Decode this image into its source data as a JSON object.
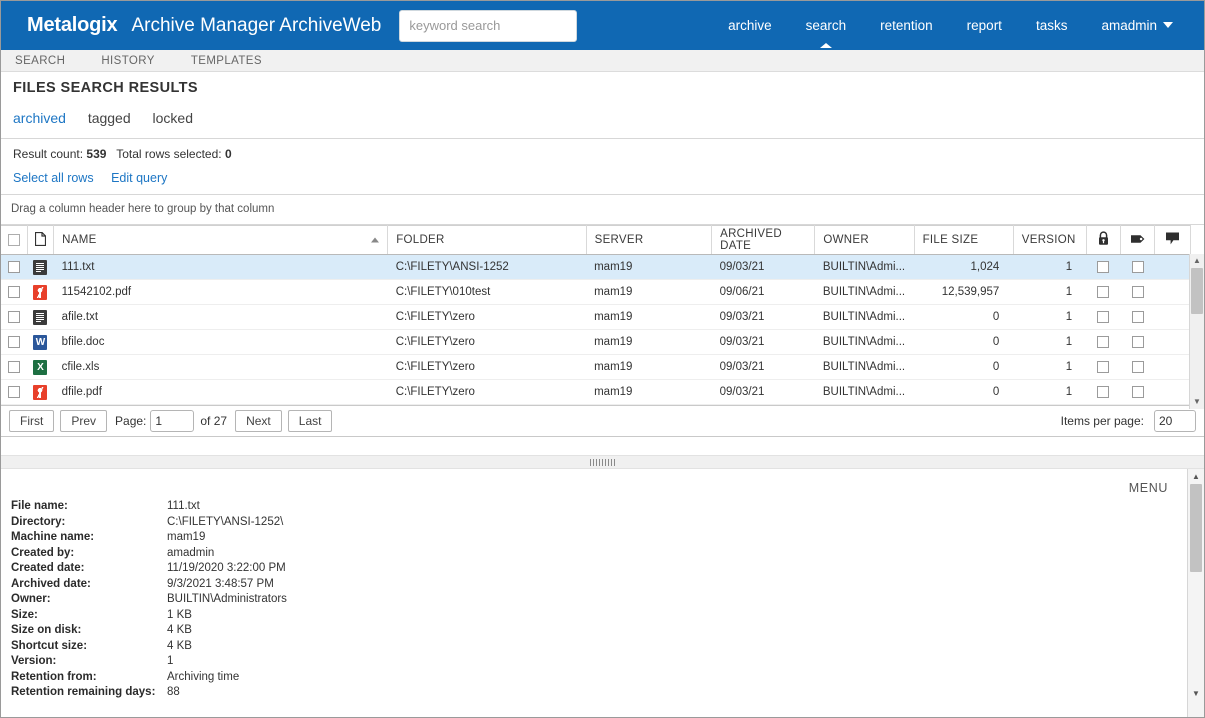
{
  "header": {
    "brand": "Metalogix",
    "app_title": "Archive Manager ArchiveWeb",
    "search_placeholder": "keyword search",
    "search_value": "",
    "accent_color": "#1068b3",
    "nav": [
      {
        "label": "archive",
        "active": false
      },
      {
        "label": "search",
        "active": true
      },
      {
        "label": "retention",
        "active": false
      },
      {
        "label": "report",
        "active": false
      },
      {
        "label": "tasks",
        "active": false
      },
      {
        "label": "amadmin",
        "active": false,
        "has_caret": true
      }
    ]
  },
  "subtabs": [
    {
      "label": "SEARCH"
    },
    {
      "label": "HISTORY"
    },
    {
      "label": "TEMPLATES"
    }
  ],
  "page": {
    "title": "FILES SEARCH RESULTS",
    "filters": [
      {
        "label": "archived",
        "active": true
      },
      {
        "label": "tagged",
        "active": false
      },
      {
        "label": "locked",
        "active": false
      }
    ]
  },
  "results": {
    "result_count_label": "Result count:",
    "result_count_value": "539",
    "total_selected_label": "Total rows selected:",
    "total_selected_value": "0",
    "links": [
      {
        "label": "Select all rows"
      },
      {
        "label": "Edit query"
      }
    ],
    "group_hint": "Drag a column header here to group by that column"
  },
  "grid": {
    "columns": [
      {
        "key": "check",
        "label": "",
        "icon": "checkbox-icon"
      },
      {
        "key": "type",
        "label": "",
        "icon": "document-icon"
      },
      {
        "key": "name",
        "label": "NAME",
        "sort": "asc"
      },
      {
        "key": "folder",
        "label": "FOLDER"
      },
      {
        "key": "server",
        "label": "SERVER"
      },
      {
        "key": "archived_date",
        "label": "ARCHIVED DATE"
      },
      {
        "key": "owner",
        "label": "OWNER"
      },
      {
        "key": "file_size",
        "label": "FILE SIZE"
      },
      {
        "key": "version",
        "label": "VERSION"
      },
      {
        "key": "locked",
        "label": "",
        "icon": "lock-icon"
      },
      {
        "key": "tagged",
        "label": "",
        "icon": "tag-icon"
      },
      {
        "key": "comment",
        "label": "",
        "icon": "comment-icon"
      }
    ],
    "rows": [
      {
        "selected": true,
        "checked": false,
        "filetype": "txt",
        "name": "111.txt",
        "folder": "C:\\FILETY\\ANSI-1252",
        "server": "mam19",
        "archived_date": "09/03/21",
        "owner": "BUILTIN\\Admi...",
        "file_size": "1,024",
        "version": "1",
        "locked": false,
        "tagged": false
      },
      {
        "selected": false,
        "checked": false,
        "filetype": "pdf",
        "name": "11542102.pdf",
        "folder": "C:\\FILETY\\010test",
        "server": "mam19",
        "archived_date": "09/06/21",
        "owner": "BUILTIN\\Admi...",
        "file_size": "12,539,957",
        "version": "1",
        "locked": false,
        "tagged": false
      },
      {
        "selected": false,
        "checked": false,
        "filetype": "txt",
        "name": "afile.txt",
        "folder": "C:\\FILETY\\zero",
        "server": "mam19",
        "archived_date": "09/03/21",
        "owner": "BUILTIN\\Admi...",
        "file_size": "0",
        "version": "1",
        "locked": false,
        "tagged": false
      },
      {
        "selected": false,
        "checked": false,
        "filetype": "doc",
        "name": "bfile.doc",
        "folder": "C:\\FILETY\\zero",
        "server": "mam19",
        "archived_date": "09/03/21",
        "owner": "BUILTIN\\Admi...",
        "file_size": "0",
        "version": "1",
        "locked": false,
        "tagged": false
      },
      {
        "selected": false,
        "checked": false,
        "filetype": "xls",
        "name": "cfile.xls",
        "folder": "C:\\FILETY\\zero",
        "server": "mam19",
        "archived_date": "09/03/21",
        "owner": "BUILTIN\\Admi...",
        "file_size": "0",
        "version": "1",
        "locked": false,
        "tagged": false
      },
      {
        "selected": false,
        "checked": false,
        "filetype": "pdf",
        "name": "dfile.pdf",
        "folder": "C:\\FILETY\\zero",
        "server": "mam19",
        "archived_date": "09/03/21",
        "owner": "BUILTIN\\Admi...",
        "file_size": "0",
        "version": "1",
        "locked": false,
        "tagged": false
      }
    ]
  },
  "pager": {
    "first": "First",
    "prev": "Prev",
    "page_label": "Page:",
    "page_value": "1",
    "of_label": "of 27",
    "next": "Next",
    "last": "Last",
    "items_per_page_label": "Items per page:",
    "items_per_page_value": "20"
  },
  "details": {
    "menu_label": "MENU",
    "fields": [
      {
        "key": "File name:",
        "value": "111.txt"
      },
      {
        "key": "Directory:",
        "value": "C:\\FILETY\\ANSI-1252\\"
      },
      {
        "key": "Machine name:",
        "value": "mam19"
      },
      {
        "key": "Created by:",
        "value": "amadmin"
      },
      {
        "key": "Created date:",
        "value": "11/19/2020 3:22:00 PM"
      },
      {
        "key": "Archived date:",
        "value": "9/3/2021 3:48:57 PM"
      },
      {
        "key": "Owner:",
        "value": "BUILTIN\\Administrators"
      },
      {
        "key": "Size:",
        "value": "1 KB"
      },
      {
        "key": "Size on disk:",
        "value": "4 KB"
      },
      {
        "key": "Shortcut size:",
        "value": "4 KB"
      },
      {
        "key": "Version:",
        "value": "1"
      },
      {
        "key": "Retention from:",
        "value": "Archiving time"
      },
      {
        "key": "Retention remaining days:",
        "value": "88"
      }
    ]
  }
}
